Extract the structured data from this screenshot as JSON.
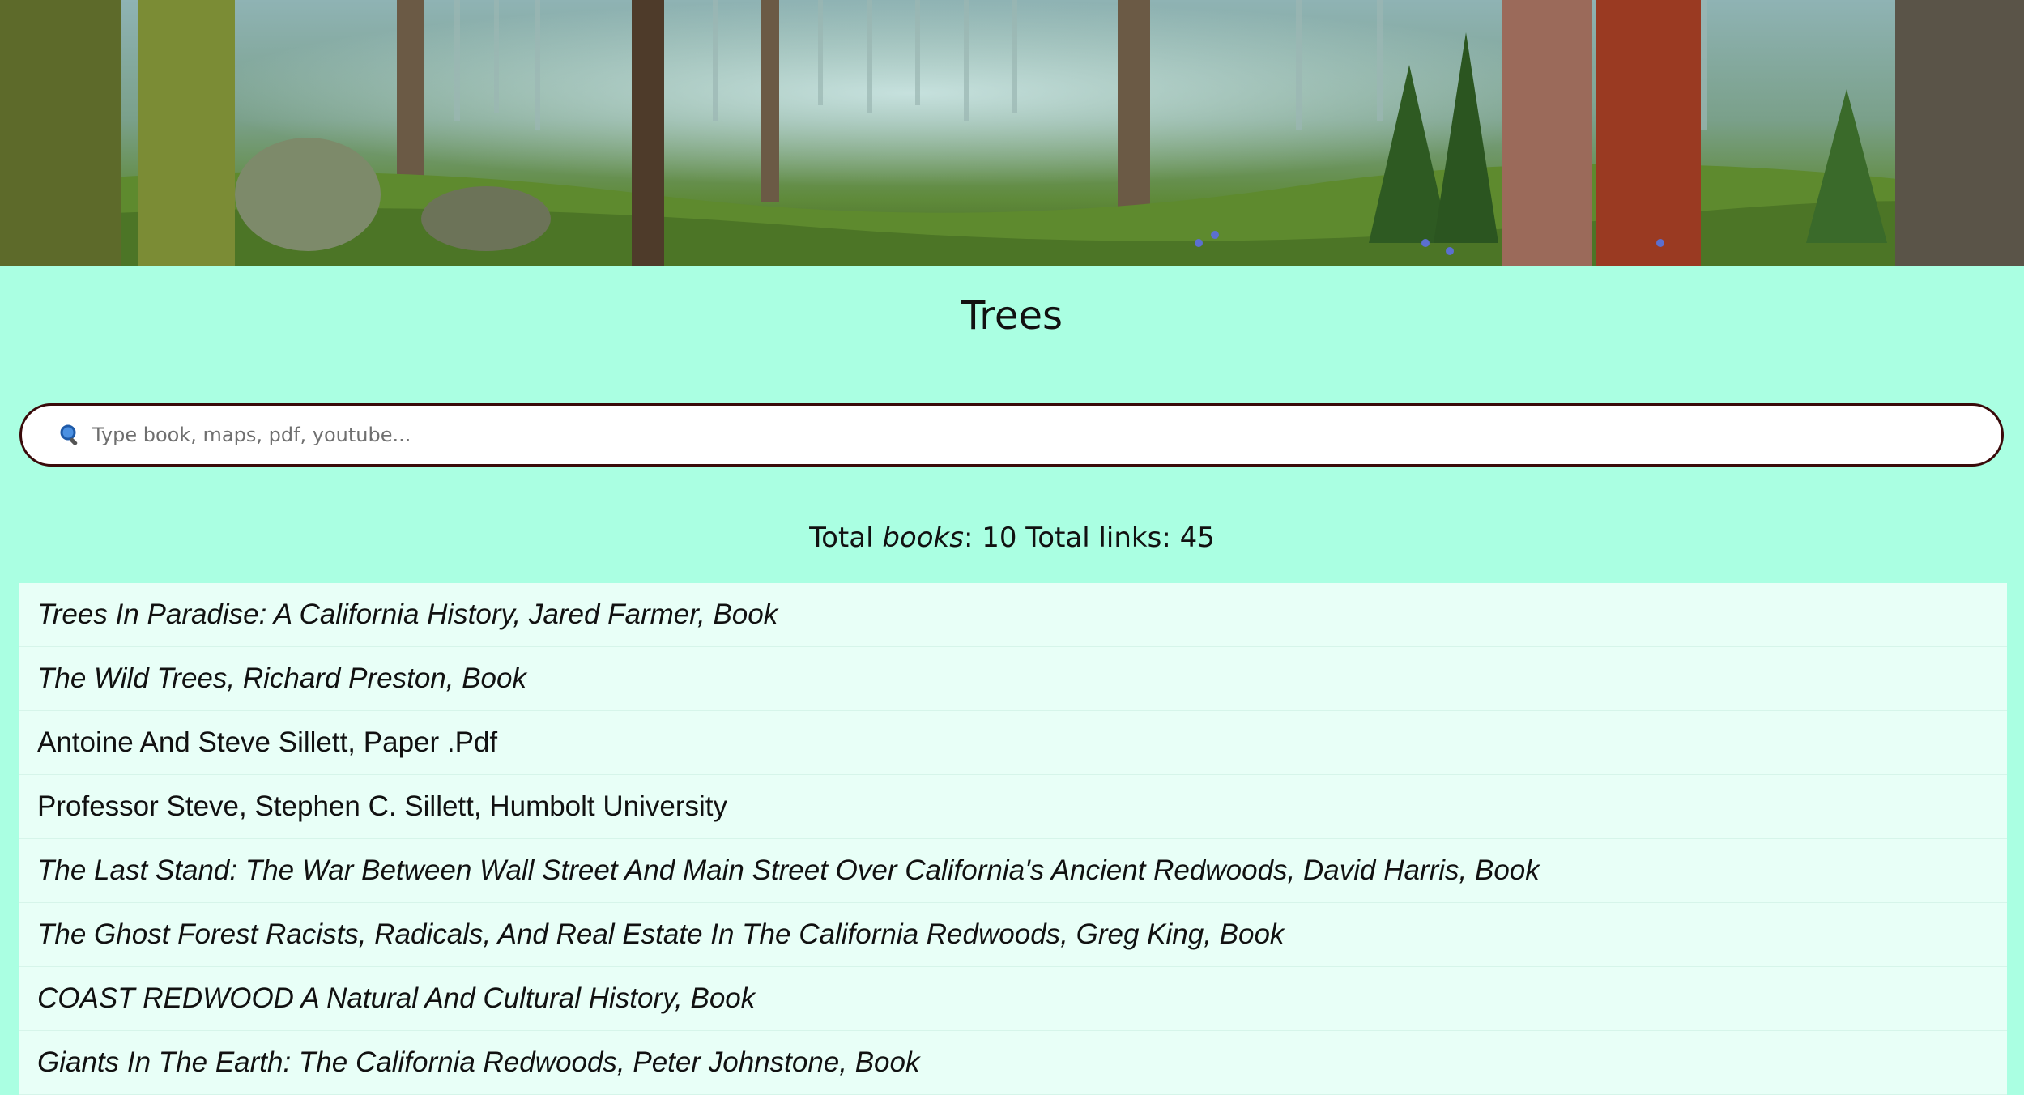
{
  "page": {
    "title": "Trees",
    "background_color": "#aaffe2"
  },
  "hero": {
    "icon": "forest-banner-image"
  },
  "search": {
    "icon": "magnifier-icon",
    "placeholder": "Type book, maps, pdf, youtube...",
    "value": ""
  },
  "totals": {
    "books_prefix": "Total ",
    "books_word": "books",
    "books_suffix": ": 10 Total links: 45"
  },
  "items": [
    {
      "label": "Trees In Paradise: A California History, Jared Farmer, Book",
      "italic": true
    },
    {
      "label": "The Wild Trees, Richard Preston, Book",
      "italic": true
    },
    {
      "label": "Antoine And Steve Sillett, Paper .Pdf",
      "italic": false
    },
    {
      "label": "Professor Steve, Stephen C. Sillett, Humbolt University",
      "italic": false
    },
    {
      "label": "The Last Stand: The War Between Wall Street And Main Street Over California's Ancient Redwoods, David Harris, Book",
      "italic": true
    },
    {
      "label": "The Ghost Forest Racists, Radicals, And Real Estate In The California Redwoods, Greg King, Book",
      "italic": true
    },
    {
      "label": "COAST REDWOOD A Natural And Cultural History, Book",
      "italic": true
    },
    {
      "label": "Giants In The Earth: The California Redwoods, Peter Johnstone, Book",
      "italic": true
    }
  ]
}
